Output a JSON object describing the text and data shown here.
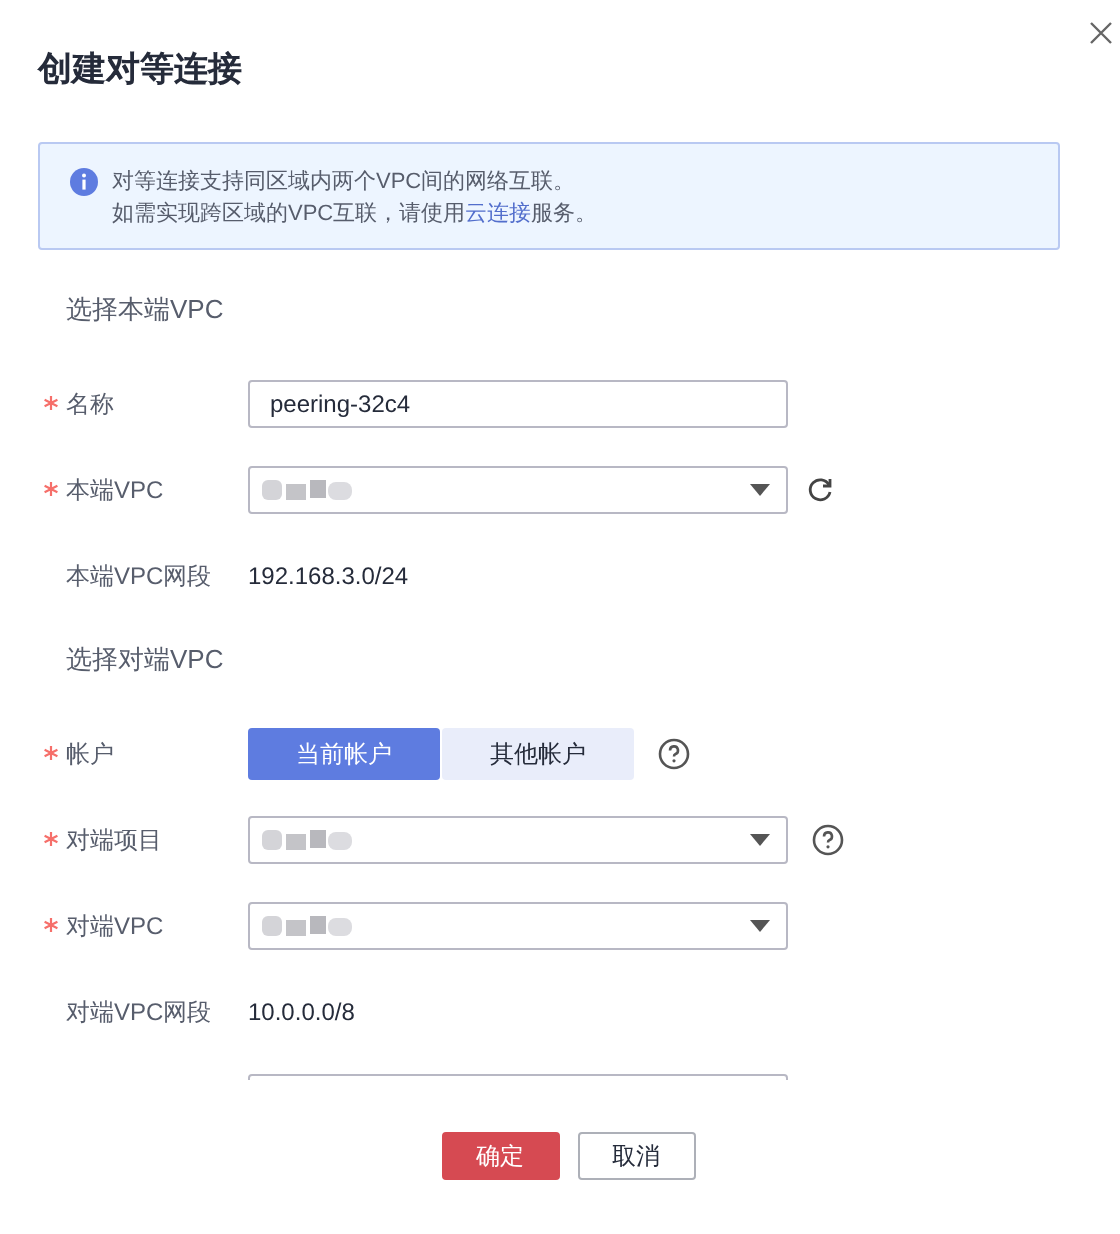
{
  "dialog": {
    "title": "创建对等连接",
    "closable": true
  },
  "notice": {
    "lines": [
      {
        "before": "对等连接支持同区域内两个VPC间的网络互联。"
      },
      {
        "before": "如需实现跨区域的VPC互联，请使用",
        "link": "云连接",
        "after": "服务。"
      }
    ]
  },
  "sections": [
    {
      "title": "选择本端VPC",
      "fields": [
        {
          "kind": "text",
          "label": "名称",
          "required": true,
          "value": "peering-32c4"
        },
        {
          "kind": "select",
          "label": "本端VPC",
          "required": true,
          "value_hidden": true,
          "refresh": true,
          "help": false
        },
        {
          "kind": "static",
          "label": "本端VPC网段",
          "required": false,
          "value": "192.168.3.0/24"
        }
      ]
    },
    {
      "title": "选择对端VPC",
      "fields": [
        {
          "kind": "toggle",
          "label": "帐户",
          "required": true,
          "help": true,
          "options": [
            {
              "label": "当前帐户",
              "selected": true
            },
            {
              "label": "其他帐户",
              "selected": false
            }
          ]
        },
        {
          "kind": "select",
          "label": "对端项目",
          "required": true,
          "value_hidden": true,
          "refresh": false,
          "help": true
        },
        {
          "kind": "select",
          "label": "对端VPC",
          "required": true,
          "value_hidden": true,
          "refresh": false,
          "help": false
        },
        {
          "kind": "static",
          "label": "对端VPC网段",
          "required": false,
          "value": "10.0.0.0/8"
        },
        {
          "kind": "partial"
        }
      ]
    }
  ],
  "buttons": [
    {
      "label": "确定",
      "kind": "primary"
    },
    {
      "label": "取消",
      "kind": "secondary"
    }
  ]
}
